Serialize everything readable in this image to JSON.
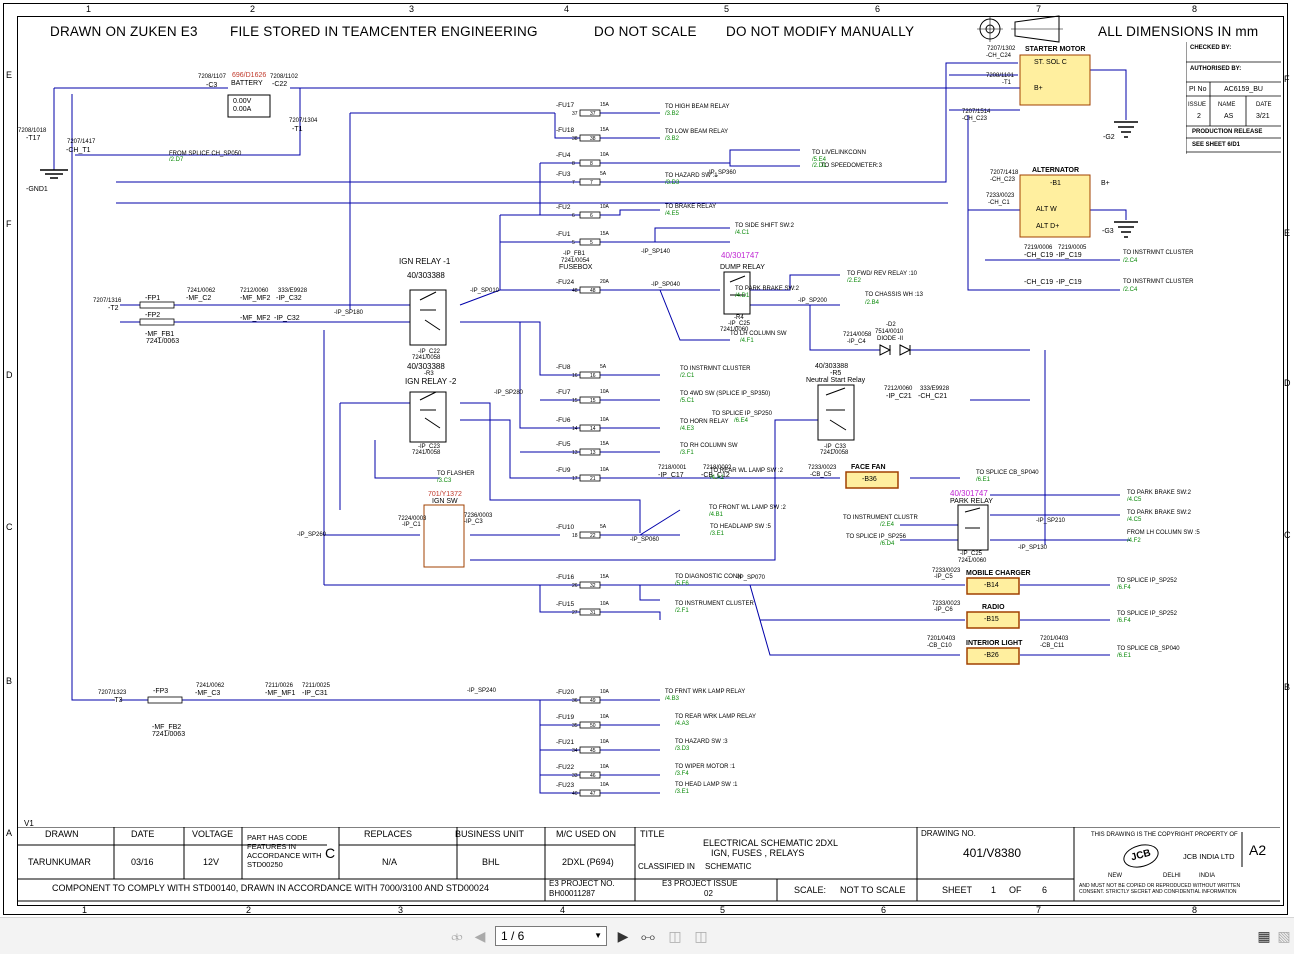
{
  "header": {
    "drawn_on": "DRAWN ON ZUKEN E3",
    "stored": "FILE STORED IN TEAMCENTER ENGINEERING",
    "scale": "DO NOT SCALE",
    "modify": "DO NOT MODIFY MANUALLY",
    "dims": "ALL DIMENSIONS IN mm"
  },
  "grid": {
    "columns": [
      "1",
      "2",
      "3",
      "4",
      "5",
      "6",
      "7",
      "8"
    ],
    "rows_left": [
      "E",
      "F",
      "D",
      "C",
      "B",
      "A"
    ],
    "rows_right": [
      "F",
      "E",
      "D",
      "C",
      "B"
    ]
  },
  "right_panel": {
    "checked_by": "CHECKED BY:",
    "authorised_by": "AUTHORISED BY:",
    "pi_no_label": "PI No",
    "pi_no": "AC6159_BU",
    "issue_label": "ISSUE",
    "issue": "2",
    "name_label": "NAME",
    "name": "AS",
    "date_label": "DATE",
    "date": "3/21",
    "release": "PRODUCTION RELEASE",
    "see_sheet": "SEE SHEET 6/D1"
  },
  "version": "V1",
  "title_block": {
    "drawn_label": "DRAWN",
    "drawn": "TARUNKUMAR",
    "date_label": "DATE",
    "date": "03/16",
    "voltage_label": "VOLTAGE",
    "voltage": "12V",
    "part_code": "PART HAS CODE FEATURES IN ACCORDANCE WITH STD00250",
    "part_code_letter": "C",
    "replaces_label": "REPLACES",
    "replaces": "N/A",
    "bu_label": "BUSINESS UNIT",
    "bu": "BHL",
    "mc_label": "M/C USED ON",
    "mc": "2DXL (P694)",
    "title_label": "TITLE",
    "title_1": "ELECTRICAL SCHEMATIC 2DXL",
    "title_2": "IGN, FUSES , RELAYS",
    "classified_label": "CLASSIFIED IN",
    "classified": "SCHEMATIC",
    "drawing_no_label": "DRAWING NO.",
    "drawing_no": "401/V8380",
    "comply": "COMPONENT TO COMPLY WITH STD00140, DRAWN IN ACCORDANCE WITH 7000/3100 AND STD00024",
    "e3_project_label": "E3 PROJECT NO.",
    "e3_project": "BH00011287",
    "e3_issue_label": "E3 PROJECT ISSUE",
    "e3_issue": "02",
    "scale_label": "SCALE:",
    "scale": "NOT TO SCALE",
    "sheet_label": "SHEET",
    "sheet": "1",
    "of_label": "OF",
    "sheet_total": "6",
    "copyright": "THIS DRAWING IS THE COPYRIGHT PROPERTY OF",
    "size": "A2",
    "company": "JCB INDIA LTD",
    "city_1": "NEW",
    "city_2": "DELHI",
    "city_3": "INDIA",
    "disclaimer": "AND MUST NOT BE COPIED OR REPRODUCED WITHOUT WRITTEN CONSENT. STRICTLY SECRET AND CONFIDENTIAL INFORMATION",
    "logo": "JCB"
  },
  "components": {
    "battery": {
      "part": "7208/1107",
      "name": "-C3",
      "part_red": "696/D1626",
      "label": "BATTERY",
      "v": "0.00V",
      "a": "0.00A",
      "c22": "7208/1102",
      "c22n": "-C22",
      "t1p": "7207/1304",
      "t1": "-T1"
    },
    "gnd1": {
      "t17p": "7208/1018",
      "t17": "-T17",
      "cht1p": "7207/1417",
      "cht1": "-CH_T1",
      "label": "-GND1",
      "from": "FROM SPLICE CH_SP050",
      "ref": "/2.D7"
    },
    "starter": {
      "title": "STARTER MOTOR",
      "sol": "ST. SOL C",
      "bplus": "B+",
      "c24p": "7207/1302",
      "c24": "-CH_C24",
      "t1p": "7208/1101",
      "t1": "-T1",
      "c23p": "7207/1514",
      "c23": "-CH_C23",
      "g2": "-G2"
    },
    "alternator": {
      "title": "ALTERNATOR",
      "b1": "-B1",
      "altw": "ALT W",
      "altd": "ALT D+",
      "bplus": "B+",
      "c23p": "7207/1418",
      "c23": "-CH_C23",
      "c1p": "7233/0023",
      "c1": "-CH_C1",
      "g3": "-G3"
    },
    "fuses": [
      {
        "id": "-FU17",
        "a": "15A",
        "n1": "37",
        "n2": "37",
        "to": "TO HIGH BEAM RELAY",
        "ref": "/3.B2"
      },
      {
        "id": "-FU18",
        "a": "15A",
        "n1": "38",
        "n2": "38",
        "to": "TO LOW BEAM RELAY",
        "ref": "/3.B2"
      },
      {
        "id": "-FU4",
        "a": "10A",
        "n1": "8",
        "n2": "8",
        "to": "TO LIVELINKCONN",
        "ref": "/5.E4"
      },
      {
        "id": "-FU3",
        "a": "5A",
        "n1": "7",
        "n2": "7",
        "to": "TO HAZARD SW :1",
        "ref": "/3.D3"
      },
      {
        "id": "-FU2",
        "a": "10A",
        "n1": "6",
        "n2": "6",
        "to": "TO BRAKE RELAY",
        "ref": "/4.E5"
      },
      {
        "id": "-FU1",
        "a": "15A",
        "n1": "5",
        "n2": "5",
        "to": "TO SIDE SHIFT SW:2",
        "ref": "/4.C1"
      },
      {
        "id": "-FU24",
        "a": "20A",
        "n1": "48",
        "n2": "48",
        "to": "TO PARK BRAKE SW:2",
        "ref": "/4.D1"
      },
      {
        "id": "-FU8",
        "a": "5A",
        "n1": "16",
        "n2": "16",
        "to": "TO INSTRMNT CLUSTER",
        "ref": "/2.C1"
      },
      {
        "id": "-FU7",
        "a": "10A",
        "n1": "15",
        "n2": "15",
        "to": "TO 4WD SW (SPLICE IP_SP350)",
        "ref": "/5.C1"
      },
      {
        "id": "-FU6",
        "a": "10A",
        "n1": "14",
        "n2": "14",
        "to": "TO HORN RELAY",
        "ref": "/4.E3"
      },
      {
        "id": "-FU5",
        "a": "15A",
        "n1": "13",
        "n2": "13",
        "to": "TO RH COLUMN SW",
        "ref": "/3.F1"
      },
      {
        "id": "-FU9",
        "a": "10A",
        "n1": "17",
        "n2": "21",
        "to": "TO REAR WL LAMP SW :2",
        "ref": "/4.A1"
      },
      {
        "id": "-FU10",
        "a": "5A",
        "n1": "18",
        "n2": "22",
        "to": "TO HEADLAMP SW :5",
        "ref": "/3.E1"
      },
      {
        "id": "-FU16",
        "a": "15A",
        "n1": "26",
        "n2": "32",
        "to": "TO DIAGNOSTIC CONN",
        "ref": "/5.F6"
      },
      {
        "id": "-FU15",
        "a": "10A",
        "n1": "27",
        "n2": "31",
        "to": "TO INSTRUMENT CLUSTER",
        "ref": "/2.F1"
      },
      {
        "id": "-FU20",
        "a": "10A",
        "n1": "36",
        "n2": "49",
        "to": "TO FRNT WRK LAMP RELAY",
        "ref": "/4.B3"
      },
      {
        "id": "-FU19",
        "a": "10A",
        "n1": "35",
        "n2": "50",
        "to": "TO REAR WRK LAMP RELAY",
        "ref": "/4.A3"
      },
      {
        "id": "-FU21",
        "a": "10A",
        "n1": "34",
        "n2": "45",
        "to": "TO HAZARD SW :3",
        "ref": "/3.D3"
      },
      {
        "id": "-FU22",
        "a": "10A",
        "n1": "33",
        "n2": "46",
        "to": "TO WIPER MOTOR :1",
        "ref": "/3.F4"
      },
      {
        "id": "-FU23",
        "a": "10A",
        "n1": "40",
        "n2": "47",
        "to": "TO HEAD LAMP SW :1",
        "ref": "/3.E1"
      }
    ],
    "relays": {
      "ign1_title": "IGN RELAY -1",
      "ign1_part": "40/303388",
      "ign1_c": "-IP_C22",
      "ign1_pn": "7241/0058",
      "ign1_r": "-R3",
      "ign2_title": "IGN RELAY -2",
      "ign2_part": "40/303388",
      "ign2_c": "-IP_C23",
      "ign2_pn": "7241/0058",
      "dump_title": "DUMP RELAY",
      "dump_part": "40/301747",
      "dump_r": "-R4",
      "dump_c": "-IP_C25",
      "dump_pn": "7241/0060",
      "neutral_title": "Neutral Start Relay",
      "neutral_part": "40/303388",
      "neutral_r": "-R5",
      "neutral_c": "-IP_C33",
      "neutral_pn": "7241/0058",
      "park_title": "PARK RELAY",
      "park_part": "40/301747",
      "park_c": "-IP_C25",
      "park_pn": "7241/0060"
    },
    "ign_sw": {
      "red": "701/Y1372",
      "title": "IGN SW",
      "c1p": "7224/0003",
      "c1": "-IP_C1",
      "c3p": "7236/0003",
      "c3": "-IP_C3"
    },
    "face_fan": {
      "title": "FACE FAN",
      "id": "-B36",
      "c5p": "7233/0023",
      "c5": "-CB_C5",
      "to": "TO SPLICE CB_SP040",
      "ref": "/6.E1"
    },
    "mobile": {
      "title": "MOBILE CHARGER",
      "id": "-B14",
      "cp": "7233/0023",
      "c": "-IP_C5",
      "to": "TO SPLICE IP_SP252",
      "ref": "/6.F4"
    },
    "radio": {
      "title": "RADIO",
      "id": "-B15",
      "cp": "7233/0023",
      "c": "-IP_C6",
      "to": "TO SPLICE IP_SP252",
      "ref": "/6.F4"
    },
    "interior": {
      "title": "INTERIOR LIGHT",
      "id": "-B26",
      "cp": "7201/0403",
      "c": "-CB_C10",
      "c2p": "7201/0403",
      "c2": "-CB_C11",
      "to": "TO SPLICE CB_SP040",
      "ref": "/6.E1"
    },
    "diode": {
      "part": "7514/0010",
      "label": "DIODE -II",
      "id": "-D2",
      "cp": "7214/0058",
      "c": "-IP_C4"
    },
    "fusebox": {
      "fb1": "-IP_FB1",
      "pn": "7241/0054",
      "label": "FUSEBOX"
    },
    "misc": {
      "fp1": "-FP1",
      "fp2": "-FP2",
      "fp3": "-FP3",
      "mffb1": "-MF_FB1",
      "mffb1pn": "7241/0063",
      "mffb2": "-MF_FB2",
      "mffb2pn": "7241/0063",
      "t2p": "7207/1316",
      "t2": "-T2",
      "t3p": "7207/1323",
      "t3": "-T3",
      "c2p": "7241/0062",
      "c2": "-MF_C2",
      "mf2p": "7212/0060",
      "mf2": "-MF_MF2",
      "ipc32p": "333/E9928",
      "ipc32": "-IP_C32",
      "c3p": "7241/0062",
      "c3": "-MF_C3",
      "mf1p": "7211/0026",
      "mf1": "-MF_MF1",
      "ipc31p": "7211/0025",
      "ipc31": "-IP_C31",
      "sp180": "-IP_SP180",
      "sp010": "-IP_SP010",
      "sp040": "-IP_SP040",
      "sp140": "-IP_SP140",
      "sp360": "-IP_SP360",
      "sp280": "-IP_SP280",
      "sp200": "-IP_SP200",
      "sp260": "-IP_SP260",
      "sp060": "-IP_SP060",
      "sp070": "-IP_SP070",
      "sp240": "-IP_SP240",
      "sp210": "-IP_SP210",
      "sp130": "-IP_SP130",
      "fwd": "TO FWD/ REV RELAY :10",
      "fwd_ref": "/2.E2",
      "chassis": "TO CHASSIS WH :13",
      "chassis_ref": "/2.B4",
      "lhcol": "TO LH COLUMN SW",
      "lhcol_ref": "/4.F1",
      "speedo": "TO SPEEDOMETER:3",
      "speedo_ref": "/2.D1",
      "flasher": "TO FLASHER",
      "flasher_ref": "/3.C3",
      "front_wl": "TO FRONT WL LAMP SW :2",
      "front_wl_ref": "/4.B1",
      "splice250": "TO SPLICE IP_SP250",
      "splice250_ref": "/6.E4",
      "instr": "TO INSTRMNT CLUSTER",
      "instr_ref": "/2.C4",
      "instr2": "TO INSTRMNT CLUSTER",
      "instr2_ref": "/2.C4",
      "park_sw": "TO PARK BRAKE SW:2",
      "park_sw_ref": "/4.C5",
      "park_sw2": "TO PARK BRAKE SW:2",
      "park_sw2_ref": "/4.C5",
      "from_lh": "FROM LH COLUMN SW :5",
      "from_lh_ref": "/4.F2",
      "instr_cl": "TO INSTRUMENT CLUSTR",
      "instr_cl_ref": "/2.E4",
      "splice_256": "TO SPLICE IP_SP256",
      "splice_256_ref": "/6.D4",
      "ipc21p": "7212/0060",
      "ipc21": "-IP_C21",
      "chc21p": "333/E9928",
      "chc21": "-CH_C21",
      "c17p": "7218/0001",
      "c17": "-IP_C17",
      "c12p": "7218/0002",
      "c12": "-CB_C12",
      "chc19p": "7219/0006",
      "chc19": "-CH_C19",
      "ipc19p": "7219/0005",
      "ipc19": "-IP_C19"
    }
  },
  "viewer": {
    "page": "1 / 6",
    "first_icon": "first-page-icon",
    "prev_icon": "prev-page-icon",
    "next_icon": "next-page-icon",
    "last_icon": "last-page-icon"
  }
}
